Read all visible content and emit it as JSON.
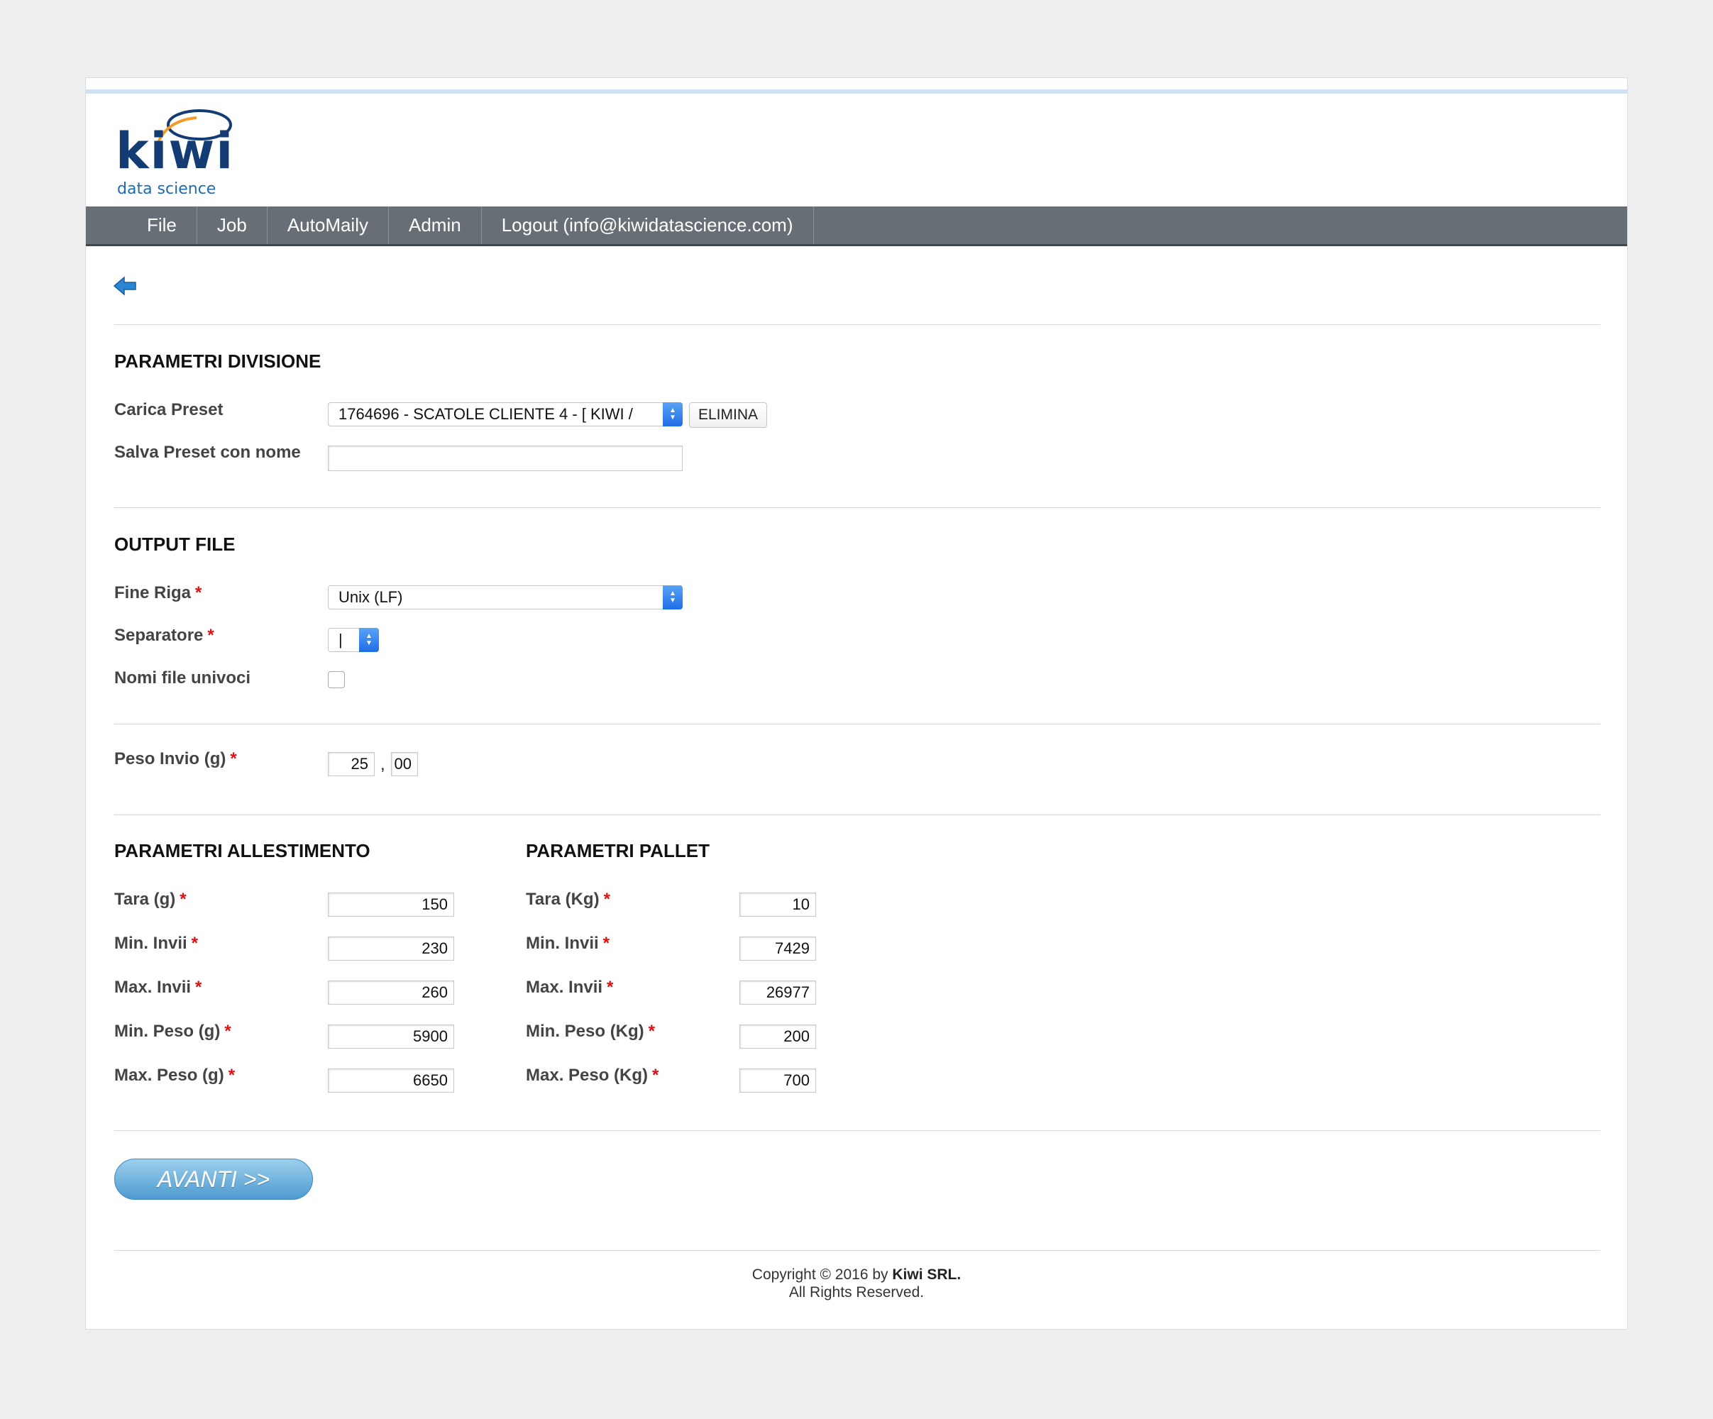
{
  "brand": {
    "name": "kiwi",
    "tagline": "data science"
  },
  "nav": [
    "File",
    "Job",
    "AutoMaily",
    "Admin",
    "Logout (info@kiwidatascience.com)"
  ],
  "divisione": {
    "title": "PARAMETRI DIVISIONE",
    "carica_label": "Carica Preset",
    "carica_value": "1764696 - SCATOLE CLIENTE 4 - [ KIWI /",
    "elimina": "ELIMINA",
    "salva_label": "Salva Preset con nome",
    "salva_value": ""
  },
  "output": {
    "title": "OUTPUT FILE",
    "fine_riga_label": "Fine Riga",
    "fine_riga_value": "Unix (LF)",
    "separatore_label": "Separatore",
    "separatore_value": "|",
    "nomi_label": "Nomi file univoci",
    "nomi_checked": false
  },
  "peso": {
    "label": "Peso Invio (g)",
    "int": "25",
    "sep": ",",
    "dec": "00"
  },
  "allestimento": {
    "title": "PARAMETRI ALLESTIMENTO",
    "fields": [
      {
        "label": "Tara (g)",
        "value": "150"
      },
      {
        "label": "Min. Invii",
        "value": "230"
      },
      {
        "label": "Max. Invii",
        "value": "260"
      },
      {
        "label": "Min. Peso (g)",
        "value": "5900"
      },
      {
        "label": "Max. Peso (g)",
        "value": "6650"
      }
    ]
  },
  "pallet": {
    "title": "PARAMETRI PALLET",
    "fields": [
      {
        "label": "Tara (Kg)",
        "value": "10"
      },
      {
        "label": "Min. Invii",
        "value": "7429"
      },
      {
        "label": "Max. Invii",
        "value": "26977"
      },
      {
        "label": "Min. Peso (Kg)",
        "value": "200"
      },
      {
        "label": "Max. Peso (Kg)",
        "value": "700"
      }
    ]
  },
  "required_mark": "*",
  "avanti": "AVANTI >>",
  "footer": {
    "line1_prefix": "Copyright © 2016 by",
    "company": "Kiwi SRL.",
    "line2": "All Rights Reserved."
  }
}
